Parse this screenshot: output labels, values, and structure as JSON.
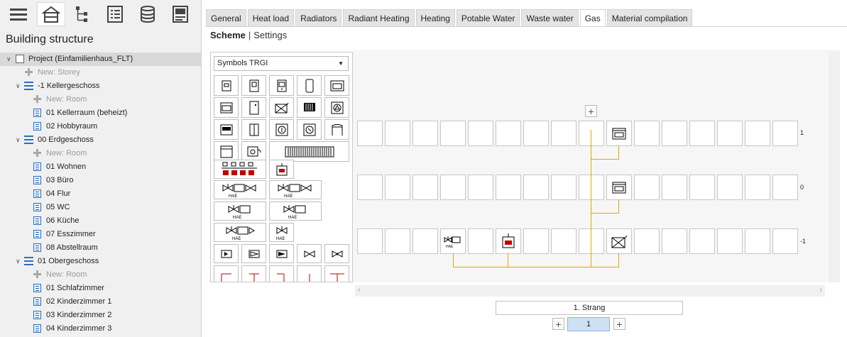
{
  "toolbar": {
    "icons": [
      "hamburger-menu-icon",
      "building-icon",
      "network-tree-icon",
      "list-icon",
      "database-icon",
      "form-icon"
    ]
  },
  "left_panel": {
    "title": "Building structure",
    "tree": [
      {
        "text": "Project (Einfamilienhaus_FLT)",
        "kind": "project"
      },
      {
        "text": "New: Storey",
        "kind": "new"
      },
      {
        "text": "-1 Kellergeschoss",
        "kind": "storey"
      },
      {
        "text": "New: Room",
        "kind": "new"
      },
      {
        "text": "01 Kellerraum (beheizt)",
        "kind": "room"
      },
      {
        "text": "02 Hobbyraum",
        "kind": "room"
      },
      {
        "text": "00 Erdgeschoss",
        "kind": "storey"
      },
      {
        "text": "New: Room",
        "kind": "new"
      },
      {
        "text": "01 Wohnen",
        "kind": "room"
      },
      {
        "text": "03 Büro",
        "kind": "room"
      },
      {
        "text": "04 Flur",
        "kind": "room"
      },
      {
        "text": "05 WC",
        "kind": "room"
      },
      {
        "text": "06 Küche",
        "kind": "room"
      },
      {
        "text": "07 Esszimmer",
        "kind": "room"
      },
      {
        "text": "08 Abstellraum",
        "kind": "room"
      },
      {
        "text": "01 Obergeschoss",
        "kind": "storey"
      },
      {
        "text": "New: Room",
        "kind": "new"
      },
      {
        "text": "01 Schlafzimmer",
        "kind": "room"
      },
      {
        "text": "02 Kinderzimmer 1",
        "kind": "room"
      },
      {
        "text": "03 Kinderzimmer 2",
        "kind": "room"
      },
      {
        "text": "04 Kinderzimmer 3",
        "kind": "room"
      }
    ]
  },
  "tabs": [
    "General",
    "Heat load",
    "Radiators",
    "Radiant Heating",
    "Heating",
    "Potable Water",
    "Waste water",
    "Gas",
    "Material compilation"
  ],
  "active_tab": "Gas",
  "subnav": {
    "scheme": "Scheme",
    "separator": "|",
    "settings": "Settings"
  },
  "palette": {
    "selected": "Symbols TRGI"
  },
  "scheme": {
    "floor_labels": [
      "1",
      "0",
      "-1"
    ],
    "strang_label": "1. Strang",
    "strang_page": "1",
    "pipe_color": "#e0a800"
  },
  "colors": {
    "accent": "#2a6fc0",
    "pipe": "#e0a800",
    "selected_page": "#cde0f4"
  }
}
